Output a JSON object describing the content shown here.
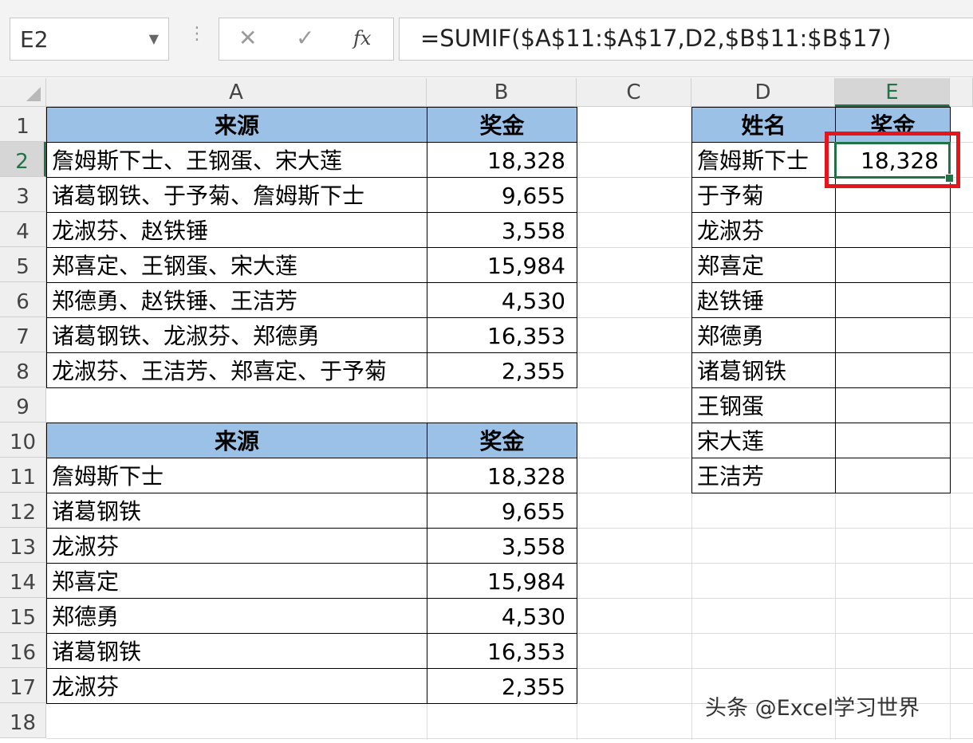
{
  "name_box": "E2",
  "formula_bar": {
    "cancel_icon": "✕",
    "enter_icon": "✓",
    "fx_label": "fx",
    "formula": "=SUMIF($A$11:$A$17,D2,$B$11:$B$17)"
  },
  "columns": [
    "A",
    "B",
    "C",
    "D",
    "E"
  ],
  "rows": [
    "1",
    "2",
    "3",
    "4",
    "5",
    "6",
    "7",
    "8",
    "9",
    "10",
    "11",
    "12",
    "13",
    "14",
    "15",
    "16",
    "17",
    "18"
  ],
  "table1": {
    "header": [
      "来源",
      "奖金"
    ],
    "rows": [
      [
        "詹姆斯下士、王钢蛋、宋大莲",
        "18,328"
      ],
      [
        "诸葛钢铁、于予菊、詹姆斯下士",
        "9,655"
      ],
      [
        "龙淑芬、赵铁锤",
        "3,558"
      ],
      [
        "郑喜定、王钢蛋、宋大莲",
        "15,984"
      ],
      [
        "郑德勇、赵铁锤、王洁芳",
        "4,530"
      ],
      [
        "诸葛钢铁、龙淑芬、郑德勇",
        "16,353"
      ],
      [
        "龙淑芬、王洁芳、郑喜定、于予菊",
        "2,355"
      ]
    ]
  },
  "table2": {
    "header": [
      "来源",
      "奖金"
    ],
    "rows": [
      [
        "詹姆斯下士",
        "18,328"
      ],
      [
        "诸葛钢铁",
        "9,655"
      ],
      [
        "龙淑芬",
        "3,558"
      ],
      [
        "郑喜定",
        "15,984"
      ],
      [
        "郑德勇",
        "4,530"
      ],
      [
        "诸葛钢铁",
        "16,353"
      ],
      [
        "龙淑芬",
        "2,355"
      ]
    ]
  },
  "table3": {
    "header": [
      "姓名",
      "奖金"
    ],
    "rows": [
      [
        "詹姆斯下士",
        "18,328"
      ],
      [
        "于予菊",
        ""
      ],
      [
        "龙淑芬",
        ""
      ],
      [
        "郑喜定",
        ""
      ],
      [
        "赵铁锤",
        ""
      ],
      [
        "郑德勇",
        ""
      ],
      [
        "诸葛钢铁",
        ""
      ],
      [
        "王钢蛋",
        ""
      ],
      [
        "宋大莲",
        ""
      ],
      [
        "王洁芳",
        ""
      ]
    ]
  },
  "watermark": "头条 @Excel学习世界",
  "colors": {
    "header_fill": "#9bc2e6",
    "selection": "#217346",
    "highlight_box": "#e8141b"
  }
}
